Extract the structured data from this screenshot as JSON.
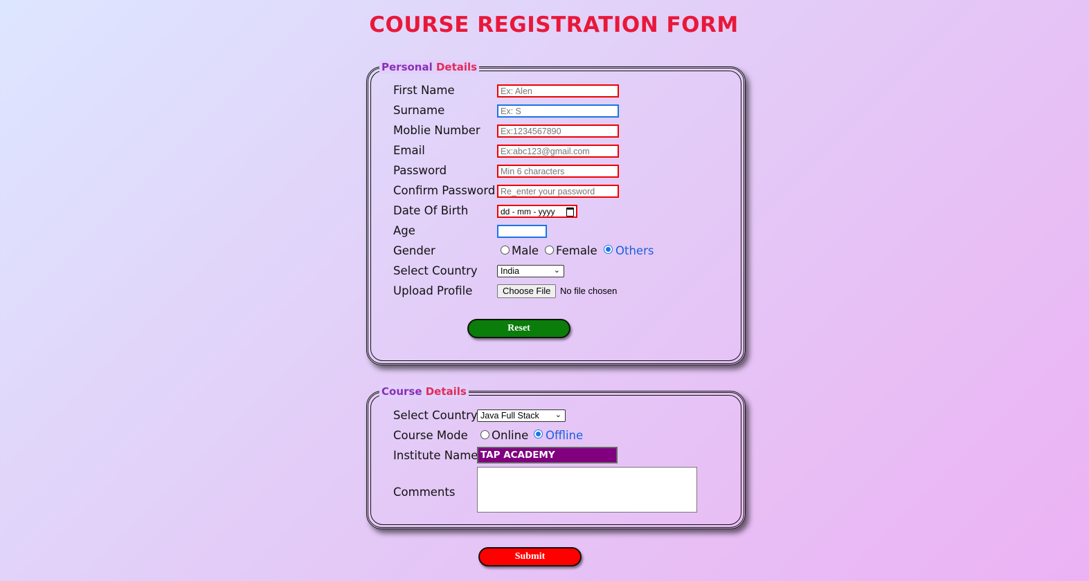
{
  "title": "COURSE REGISTRATION FORM",
  "personal": {
    "legend_part1": "Personal",
    "legend_part2": "Details",
    "labels": {
      "first_name": "First Name",
      "surname": "Surname",
      "mobile": "Moblie Number",
      "email": "Email",
      "password": "Password",
      "confirm": "Confirm Password",
      "dob": "Date Of Birth",
      "age": "Age",
      "gender": "Gender",
      "country": "Select Country",
      "upload": "Upload Profile"
    },
    "placeholders": {
      "first_name": "Ex: Alen",
      "surname": "Ex: S",
      "mobile": "Ex:1234567890",
      "email": "Ex:abc123@gmail.com",
      "password": "Min 6 characters",
      "confirm": "Re_enter your password",
      "dob": "dd - mm - yyyy"
    },
    "gender_options": [
      "Male",
      "Female",
      "Others"
    ],
    "gender_selected": "Others",
    "country_value": "India",
    "file_button": "Choose File",
    "file_status": "No file chosen",
    "reset_label": "Reset"
  },
  "course": {
    "legend_part1": "Course",
    "legend_part2": "Details",
    "labels": {
      "country": "Select Country",
      "mode": "Course Mode",
      "institute": "Institute Name",
      "comments": "Comments"
    },
    "course_value": "Java Full Stack",
    "mode_options": [
      "Online",
      "Offline"
    ],
    "mode_selected": "Offline",
    "institute_value": "TAP ACADEMY"
  },
  "submit_label": "Submit",
  "colors": {
    "title": "#e8183a",
    "reset": "#0a7d0a",
    "submit": "#ff0000",
    "institute_bg": "#800080",
    "invalid_border": "#e00000",
    "focus_border": "#1a73e8"
  }
}
